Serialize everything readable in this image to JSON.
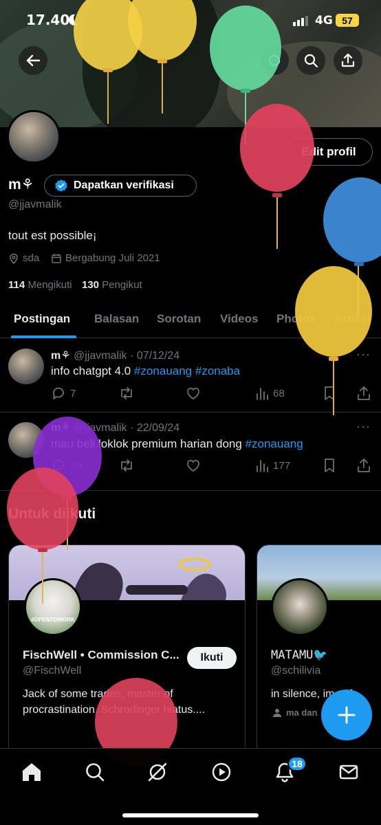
{
  "status_bar": {
    "time": "17.40",
    "network": "4G",
    "battery": "57"
  },
  "profile": {
    "display_name": "m⚘",
    "verify_label": "Dapatkan verifikasi",
    "handle": "@jjavmalik",
    "bio": "tout est possible¡",
    "location": "sda",
    "joined": "Bergabung Juli 2021",
    "following_count": "114",
    "following_label": "Mengikuti",
    "followers_count": "130",
    "followers_label": "Pengikut",
    "edit_label": "Edit profil"
  },
  "tabs": [
    "Postingan",
    "Balasan",
    "Sorotan",
    "Videos",
    "Photos",
    "Artikel"
  ],
  "posts": [
    {
      "name": "m⚘",
      "handle": "@jjavmalik",
      "date": "07/12/24",
      "text": "info chatgpt 4.0",
      "hashtags": "#zonauang #zonaba",
      "replies": "7",
      "views": "68"
    },
    {
      "name": "m⚘",
      "handle": "@jjavmalik",
      "date": "22/09/24",
      "text": "mau beli loklok premium harian dong",
      "hashtags": "#zonauang",
      "replies": "39",
      "views": "177"
    }
  ],
  "who_to_follow": {
    "title": "Untuk diikuti",
    "cards": [
      {
        "name": "FischWell • Commission C...",
        "handle": "@FischWell",
        "bio_line1": "Jack of some trades, master of",
        "bio_line2": "procrastination. Schrodinger hiatus....",
        "follow_label": "Ikuti",
        "avatar_tag": "#OPENTOWORK"
      },
      {
        "name": "MATAMU🐦",
        "handle": "@schilivia",
        "bio_line1": "in silence, im safe",
        "followed_by": "ma dan"
      }
    ]
  },
  "bottom_nav": {
    "notifications_badge": "18"
  },
  "colors": {
    "accent": "#1d9bf0",
    "background": "#000000",
    "muted": "#71767b"
  }
}
